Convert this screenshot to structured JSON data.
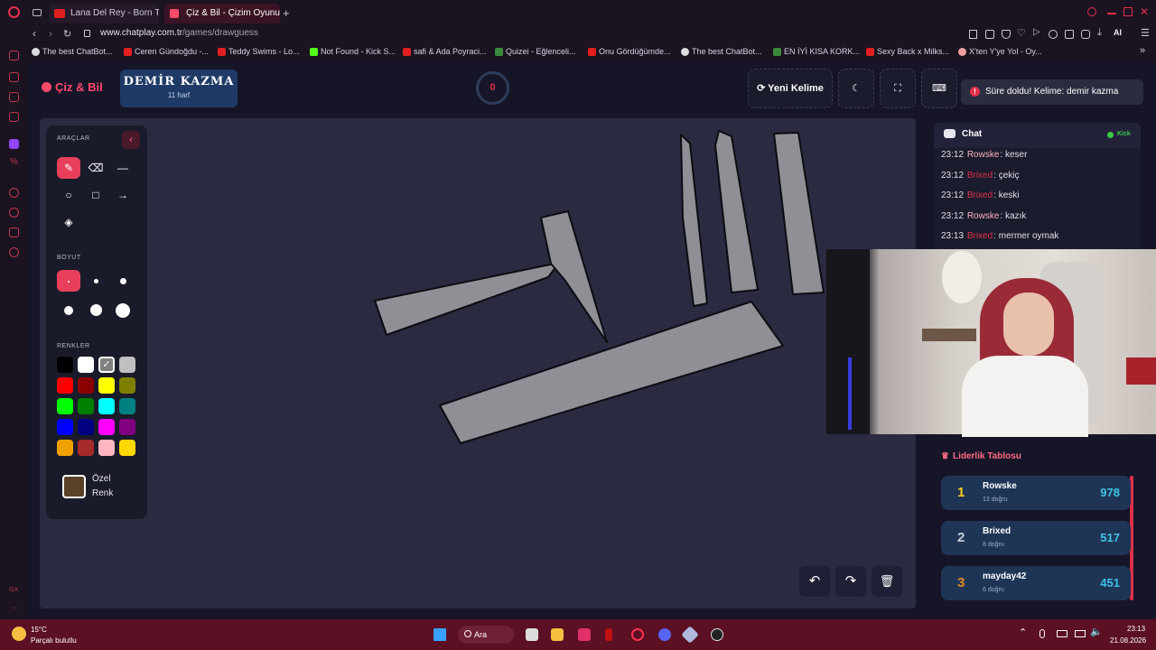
{
  "browser": {
    "tabs": [
      {
        "label": "Lana Del Rey - Born To"
      },
      {
        "label": "Çiz & Bil - Çizim Oyunu"
      }
    ],
    "new_tab": "+",
    "url_host": "www.chatplay.com.tr",
    "url_path": "/games/drawguess",
    "ai_label": "AI",
    "bookmarks": [
      "The best ChatBot...",
      "Ceren Gündoğdu -...",
      "Teddy Swims - Lo...",
      "Not Found - Kick S...",
      "safi & Ada Poyraci...",
      "Quizei - Eğlenceli...",
      "Onu Gördüğümde...",
      "The best ChatBot...",
      "EN İYİ KISA KORK...",
      "Sexy Back x Milks...",
      "X'ten Y'ye Yol - Oy..."
    ]
  },
  "app": {
    "logo": "Çiz & Bil",
    "word": "DEMİR KAZMA",
    "word_hint": "11 harf",
    "timer": "0",
    "new_word_label": "Yeni Kelime",
    "toast": "Süre doldu! Kelime: demir kazma"
  },
  "tools": {
    "tools_label": "ARAÇLAR",
    "size_label": "BOYUT",
    "colors_label": "RENKLER",
    "custom_color_line1": "Özel",
    "custom_color_line2": "Renk",
    "custom_color": "#5a4128",
    "palette": [
      "#000000",
      "#ffffff",
      "#808080",
      "#c0c0c0",
      "#ff0000",
      "#8b0000",
      "#ffff00",
      "#808000",
      "#00ff00",
      "#008000",
      "#00ffff",
      "#008080",
      "#0000ff",
      "#000080",
      "#ff00ff",
      "#800080",
      "#f0a000",
      "#a52a2a",
      "#ffb6c1",
      "#ffd700"
    ]
  },
  "chat": {
    "title": "Chat",
    "platform": "Kick",
    "messages": [
      {
        "time": "23:12",
        "user": "Rowske",
        "color": "#ffb0c0",
        "text": "keser"
      },
      {
        "time": "23:12",
        "user": "Brixed",
        "color": "#e0304a",
        "text": "çekiç"
      },
      {
        "time": "23:12",
        "user": "Brixed",
        "color": "#e0304a",
        "text": "keski"
      },
      {
        "time": "23:12",
        "user": "Rowske",
        "color": "#ffb0c0",
        "text": "kazık"
      },
      {
        "time": "23:13",
        "user": "Brixed",
        "color": "#e0304a",
        "text": "mermer oymak"
      }
    ]
  },
  "leaderboard": {
    "title": "Liderlik Tablosu",
    "entries": [
      {
        "rank": "1",
        "name": "Rowske",
        "correct": "13 doğru",
        "score": "978",
        "rank_color": "#f5d020"
      },
      {
        "rank": "2",
        "name": "Brixed",
        "correct": "8 doğru",
        "score": "517",
        "rank_color": "#c8d0dc"
      },
      {
        "rank": "3",
        "name": "mayday42",
        "correct": "6 doğru",
        "score": "451",
        "rank_color": "#e08a2a"
      }
    ]
  },
  "taskbar": {
    "temp": "15°C",
    "weather": "Parçalı bulutlu",
    "search": "Ara",
    "time": "23:13",
    "date": "21.08.2026"
  }
}
